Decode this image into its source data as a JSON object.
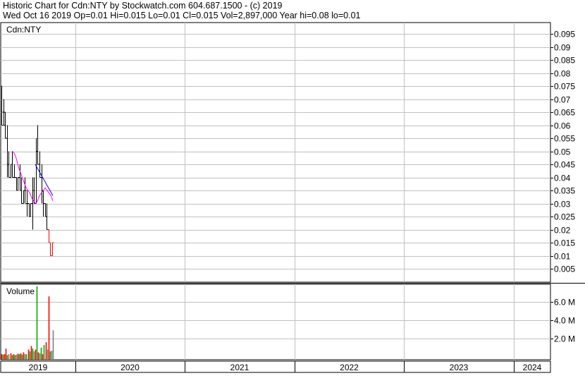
{
  "header": {
    "line1": "Historic Chart for Cdn:NTY by Stockwatch.com 604.687.1500 - (c) 2019",
    "line2": "Wed Oct 16 2019   Op=0.01   Hi=0.015   Lo=0.01   Cl=0.015   Vol=2,897,000   Year hi=0.08   lo=0.01"
  },
  "colors": {
    "background": "#ffffff",
    "grid": "#c0c0c0",
    "frame": "#000000",
    "price_bar": "#000000",
    "price_bar_red": "#ff0000",
    "ma_fast": "#ff00ff",
    "ma_slow": "#0000ff",
    "vol_up": "#00aa00",
    "vol_down": "#ff0000",
    "vol_flat": "#808080"
  },
  "chart_data": [
    {
      "type": "line",
      "title": "Cdn:NTY",
      "ylim": [
        0,
        0.1
      ],
      "y_ticks": [
        "0.095",
        "0.09",
        "0.085",
        "0.08",
        "0.075",
        "0.07",
        "0.065",
        "0.06",
        "0.055",
        "0.05",
        "0.045",
        "0.04",
        "0.035",
        "0.03",
        "0.025",
        "0.02",
        "0.015",
        "0.01",
        "0.005"
      ],
      "x_categories": [
        "2019",
        "2020",
        "2021",
        "2022",
        "2023",
        "2024"
      ],
      "grid": true,
      "ohlc": [
        [
          0.075,
          0.075,
          0.06,
          0.06
        ],
        [
          0.065,
          0.07,
          0.06,
          0.065
        ],
        [
          0.06,
          0.065,
          0.055,
          0.055
        ],
        [
          0.055,
          0.06,
          0.04,
          0.045
        ],
        [
          0.045,
          0.05,
          0.04,
          0.04
        ],
        [
          0.04,
          0.045,
          0.04,
          0.045
        ],
        [
          0.045,
          0.05,
          0.04,
          0.04
        ],
        [
          0.04,
          0.045,
          0.04,
          0.04
        ],
        [
          0.04,
          0.04,
          0.035,
          0.035
        ],
        [
          0.035,
          0.04,
          0.035,
          0.04
        ],
        [
          0.04,
          0.045,
          0.035,
          0.035
        ],
        [
          0.035,
          0.04,
          0.03,
          0.03
        ],
        [
          0.03,
          0.035,
          0.03,
          0.035
        ],
        [
          0.035,
          0.04,
          0.03,
          0.035
        ],
        [
          0.03,
          0.035,
          0.025,
          0.03
        ],
        [
          0.03,
          0.03,
          0.025,
          0.025
        ],
        [
          0.025,
          0.03,
          0.025,
          0.03
        ],
        [
          0.03,
          0.04,
          0.02,
          0.035
        ],
        [
          0.035,
          0.04,
          0.03,
          0.03
        ],
        [
          0.03,
          0.055,
          0.03,
          0.05
        ],
        [
          0.05,
          0.06,
          0.045,
          0.045
        ],
        [
          0.045,
          0.05,
          0.04,
          0.04
        ],
        [
          0.04,
          0.045,
          0.03,
          0.035
        ],
        [
          0.035,
          0.035,
          0.025,
          0.03
        ],
        [
          0.03,
          0.03,
          0.025,
          0.025
        ],
        [
          0.025,
          0.03,
          0.02,
          0.02
        ],
        [
          0.02,
          0.02,
          0.015,
          0.015
        ],
        [
          0.015,
          0.015,
          0.01,
          0.01
        ],
        [
          0.01,
          0.015,
          0.01,
          0.015
        ]
      ],
      "series": [
        {
          "values": [
            0.05,
            0.049,
            0.047,
            0.044,
            0.042,
            0.04,
            0.038,
            0.036,
            0.035,
            0.034,
            0.032,
            0.031,
            0.03,
            0.031,
            0.033,
            0.034,
            0.035,
            0.036,
            0.035,
            0.034,
            0.033,
            0.031
          ]
        },
        {
          "values": [
            0.045,
            0.044,
            0.043,
            0.042,
            0.041,
            0.04,
            0.039,
            0.038,
            0.037,
            0.036,
            0.035,
            0.034,
            0.033
          ]
        }
      ]
    },
    {
      "type": "bar",
      "title": "Volume",
      "ylim": [
        0,
        8000000
      ],
      "y_ticks": [
        "6.0 M",
        "4.0 M",
        "2.0 M"
      ],
      "values": [
        0.3,
        0.25,
        0.3,
        0.9,
        0.2,
        0.3,
        0.4,
        0.2,
        0.3,
        0.2,
        0.25,
        0.35,
        0.3,
        0.4,
        0.25,
        0.5,
        0.3,
        0.3,
        0.8,
        0.6,
        1.2,
        0.9,
        0.6,
        0.8,
        7.7,
        0.5,
        0.4,
        1.0,
        0.3,
        1.3,
        1.6,
        0.8,
        6.6,
        0.6,
        0.7,
        2.9
      ],
      "colors": [
        "red",
        "green",
        "red",
        "red",
        "green",
        "gray",
        "red",
        "green",
        "red",
        "green",
        "gray",
        "red",
        "green",
        "red",
        "green",
        "red",
        "gray",
        "green",
        "red",
        "green",
        "red",
        "green",
        "gray",
        "red",
        "green",
        "red",
        "gray",
        "green",
        "red",
        "green",
        "red",
        "gray",
        "red",
        "green",
        "gray",
        "gray"
      ]
    }
  ]
}
